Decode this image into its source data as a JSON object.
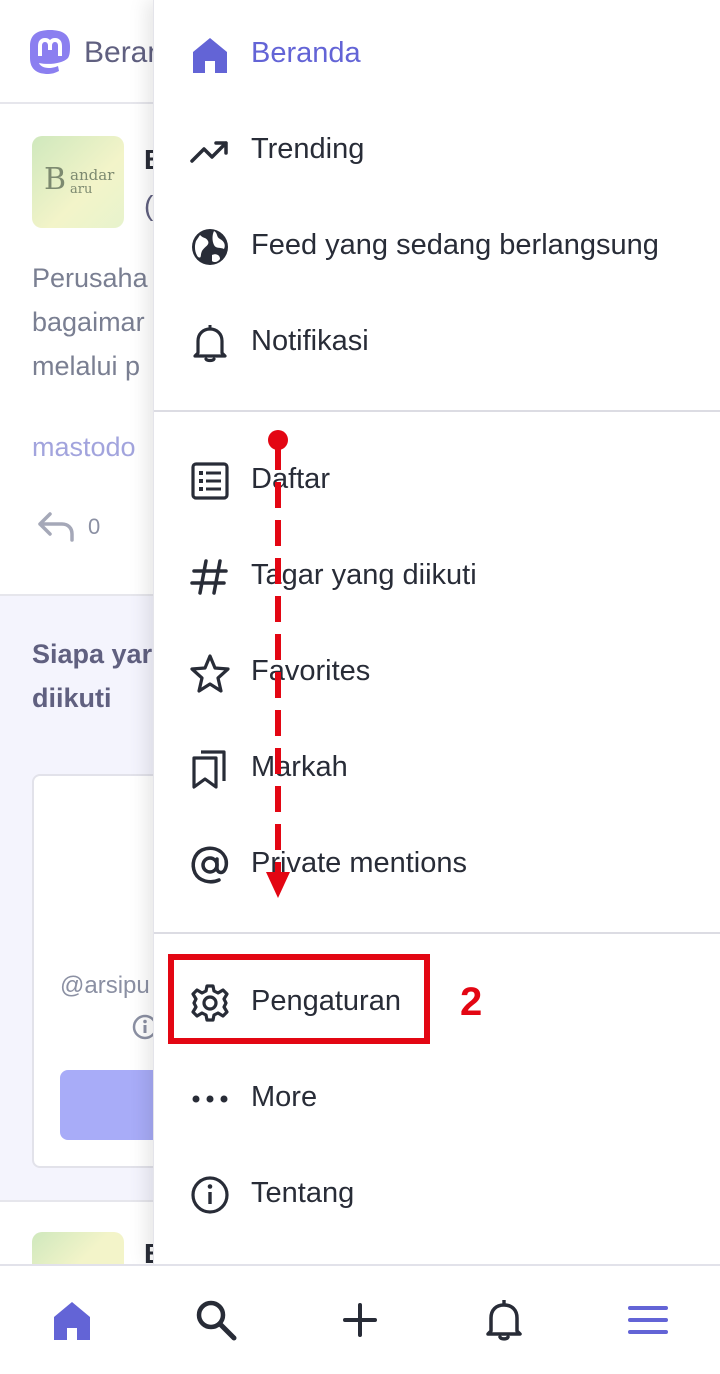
{
  "topbar": {
    "title": "Beranda"
  },
  "post": {
    "avatar_text": "B",
    "avatar_small_1": "andar",
    "avatar_small_2": "aru",
    "name": "B",
    "handle": "(",
    "text_lines": [
      "Perusaha",
      "bagaimar",
      "melalui p"
    ],
    "link": "mastodo",
    "reply_count": "0"
  },
  "suggestions": {
    "title_line1": "Siapa yar",
    "title_line2": "diikuti",
    "handle": "@arsipu"
  },
  "post2": {
    "name": "B"
  },
  "drawer": {
    "items": [
      {
        "label": "Beranda",
        "icon": "home-icon",
        "active": true
      },
      {
        "label": "Trending",
        "icon": "trending-icon"
      },
      {
        "label": "Feed yang sedang berlangsung",
        "icon": "globe-icon"
      },
      {
        "label": "Notifikasi",
        "icon": "bell-icon"
      },
      {
        "label": "Daftar",
        "icon": "list-icon"
      },
      {
        "label": "Tagar yang diikuti",
        "icon": "hashtag-icon"
      },
      {
        "label": "Favorites",
        "icon": "star-icon"
      },
      {
        "label": "Markah",
        "icon": "bookmarks-icon"
      },
      {
        "label": "Private mentions",
        "icon": "at-icon"
      },
      {
        "label": "Pengaturan",
        "icon": "gear-icon"
      },
      {
        "label": "More",
        "icon": "more-icon"
      },
      {
        "label": "Tentang",
        "icon": "info-icon"
      }
    ]
  },
  "annotation": {
    "step": "2"
  },
  "colors": {
    "accent": "#6364d6",
    "annotation_red": "#e30613",
    "text": "#282c37"
  },
  "bottom_tabs": [
    "home-icon",
    "search-icon",
    "compose-icon",
    "notifications-icon",
    "menu-icon"
  ]
}
